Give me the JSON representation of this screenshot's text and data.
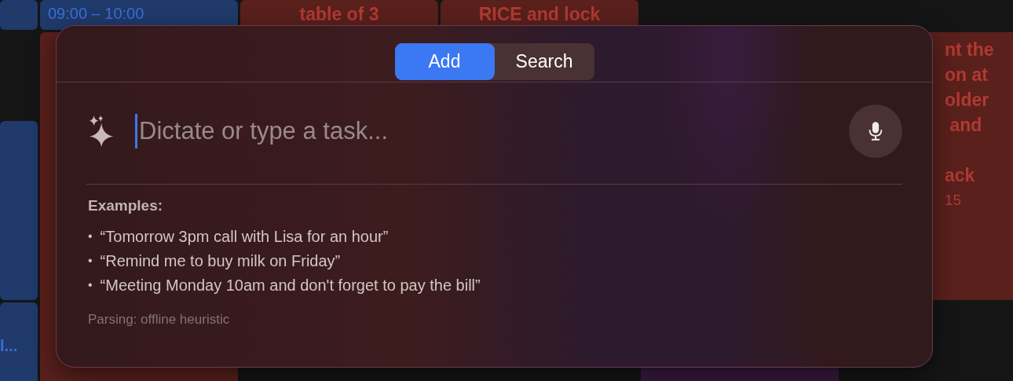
{
  "calendar": {
    "events": [
      {
        "color": "#1f3a6b"
      },
      {
        "lines": [
          "09:00 – 10:00"
        ],
        "color": "#1f3a6b"
      },
      {
        "lines": [
          "table of 3"
        ],
        "color": "#5a201c"
      },
      {
        "lines": [
          "RICE and lock"
        ],
        "color": "#5a201c"
      },
      {
        "lines": [
          "nt the",
          "on at",
          "older",
          " and",
          "ack",
          "15"
        ],
        "color": "#5a201c"
      },
      {
        "color": "#5a201c"
      },
      {
        "color": "#1f3a6b"
      },
      {
        "lines": [
          "l..."
        ],
        "color": "#1f3a6b"
      },
      {
        "color": "#3a1a40"
      }
    ]
  },
  "dialog": {
    "tabs": [
      {
        "label": "Add",
        "selected": true
      },
      {
        "label": "Search",
        "selected": false
      }
    ],
    "input": {
      "placeholder": "Dictate or type a task..."
    },
    "examples_title": "Examples:",
    "examples": [
      {
        "bullet": "•",
        "text": "“Tomorrow 3pm call with Lisa for an hour”"
      },
      {
        "bullet": "•",
        "text": "“Remind me to buy milk on Friday”"
      },
      {
        "bullet": "•",
        "text": "“Meeting Monday 10am and don't forget to pay the bill”"
      }
    ],
    "status": "Parsing: offline heuristic"
  }
}
